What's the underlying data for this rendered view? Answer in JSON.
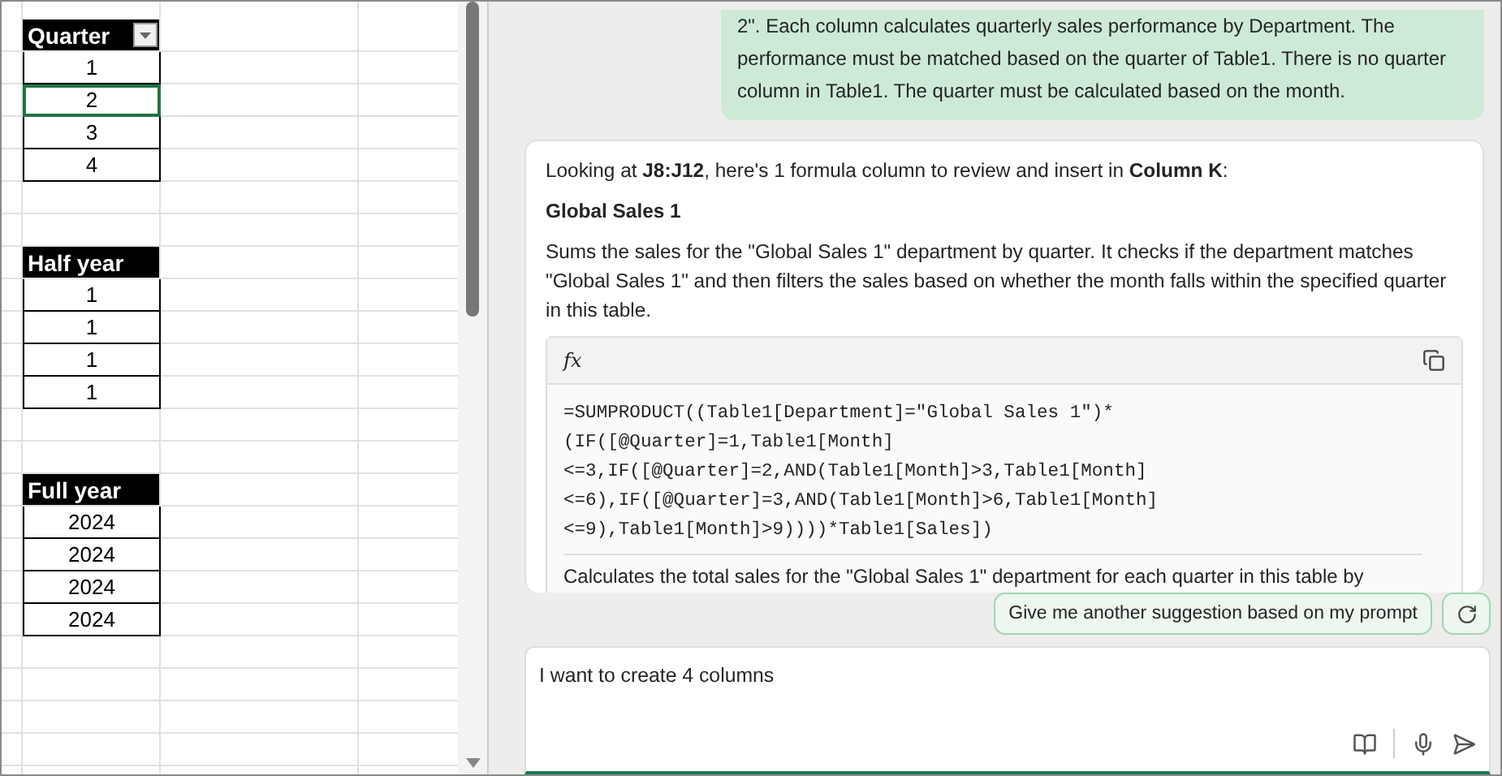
{
  "sheet": {
    "tables": [
      {
        "header": "Quarter",
        "filter_button": true,
        "rows": [
          {
            "value": "1",
            "selected": false
          },
          {
            "value": "2",
            "selected": true
          },
          {
            "value": "3",
            "selected": false
          },
          {
            "value": "4",
            "selected": false
          }
        ]
      },
      {
        "header": "Half year",
        "filter_button": false,
        "rows": [
          {
            "value": "1",
            "selected": false
          },
          {
            "value": "1",
            "selected": false
          },
          {
            "value": "1",
            "selected": false
          },
          {
            "value": "1",
            "selected": false
          }
        ]
      },
      {
        "header": "Full year",
        "filter_button": false,
        "rows": [
          {
            "value": "2024",
            "selected": false
          },
          {
            "value": "2024",
            "selected": false
          },
          {
            "value": "2024",
            "selected": false
          },
          {
            "value": "2024",
            "selected": false
          }
        ]
      }
    ]
  },
  "chat": {
    "user_message": "2\". Each column calculates quarterly sales performance by Department. The performance must be matched based on the quarter of Table1. There is no quarter column in Table1. The quarter must be calculated based on the month.",
    "reply": {
      "intro": "Looking at **J8:J12**, here's 1 formula column to review and insert in **Column K**:",
      "heading": "Global Sales 1",
      "description": "Sums the sales for the \"Global Sales 1\" department by quarter. It checks if the department matches \"Global Sales 1\" and then filters the sales based on whether the month falls within the specified quarter in this table.",
      "formula_lines": [
        "=SUMPRODUCT((Table1[Department]=\"Global Sales 1\")*",
        "(IF([@Quarter]=1,Table1[Month]",
        "<=3,IF([@Quarter]=2,AND(Table1[Month]>3,Table1[Month]",
        "<=6),IF([@Quarter]=3,AND(Table1[Month]>6,Table1[Month]",
        "<=9),Table1[Month]>9))))*Table1[Sales])"
      ],
      "fx_label": "fx",
      "explanation": "Calculates the total sales for the \"Global Sales 1\" department for each quarter in this table by"
    },
    "suggestion": "Give me another suggestion based on my prompt",
    "input_value": "I want to create 4 columns"
  }
}
